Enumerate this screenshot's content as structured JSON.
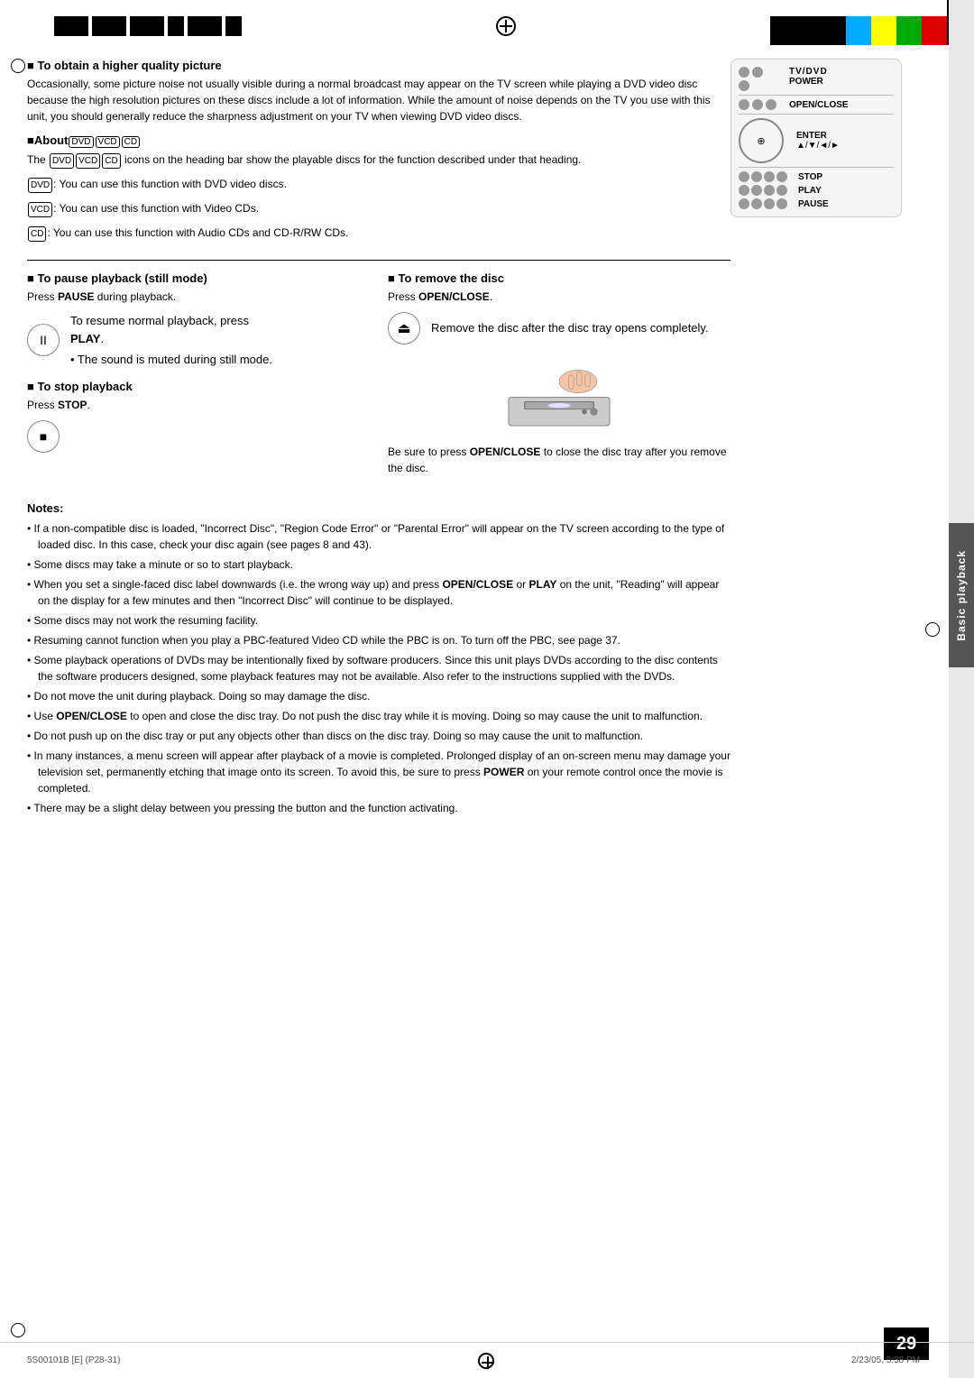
{
  "header": {
    "page_number": "29",
    "footer_left": "5S00101B [E] (P28-31)",
    "footer_center_page": "29",
    "footer_right": "2/23/05, 5:38 PM"
  },
  "sidebar": {
    "label": "Basic playback"
  },
  "top_section": {
    "higher_quality": {
      "heading": "To obtain a higher quality picture",
      "body": "Occasionally, some picture noise not usually visible during a normal broadcast may appear on the TV screen while playing a DVD video disc because the high resolution pictures on these discs include a lot of information. While the amount of noise depends on the TV you use with this unit, you should generally reduce the sharpness adjustment on your TV when viewing DVD video discs."
    },
    "about": {
      "heading": "About",
      "disc_labels": [
        "DVD",
        "VCD",
        "CD"
      ],
      "body": "icons on the heading bar show the playable discs for the function described under that heading.",
      "dvd_label": "DVD",
      "dvd_text": ": You can use this function with DVD video discs.",
      "vcd_label": "VCD",
      "vcd_text": ": You can use this function with Video CDs.",
      "cd_label": "CD",
      "cd_text": ": You can use this function with Audio CDs and CD-R/RW CDs."
    }
  },
  "remote": {
    "tv_dvd_label": "TV/DVD",
    "power_label": "POWER",
    "open_close_label": "OPEN/CLOSE",
    "enter_label": "ENTER",
    "nav_label": "▲/▼/◄/►",
    "stop_label": "STOP",
    "play_label": "PLAY",
    "pause_label": "PAUSE"
  },
  "middle_section": {
    "pause": {
      "heading": "To pause playback (still mode)",
      "press_text": "Press PAUSE during playback.",
      "pause_icon": "II",
      "resume_text": "To resume normal playback, press",
      "play_bold": "PLAY",
      "bullet": "The sound is muted during still mode."
    },
    "stop": {
      "heading": "To stop playback",
      "press_text": "Press STOP.",
      "stop_icon": "■"
    },
    "remove": {
      "heading": "To remove the disc",
      "press_text": "Press OPEN/CLOSE.",
      "open_close_icon": "⏏",
      "remove_text": "Remove the disc after the disc tray opens completely.",
      "note": "Be sure to press OPEN/CLOSE to close the disc tray after you remove the disc."
    }
  },
  "notes": {
    "heading": "Notes:",
    "items": [
      "If a non-compatible disc is loaded, \"Incorrect Disc\", \"Region Code Error\" or \"Parental Error\" will appear on the TV screen according to the type of loaded disc. In this case, check your disc again (see pages 8 and 43).",
      "Some discs may take a minute or so to start playback.",
      "When you set a single-faced disc label downwards (i.e. the wrong way up) and press OPEN/CLOSE or PLAY on the unit, \"Reading\" will appear on the display for a few minutes and then \"Incorrect Disc\" will continue to be displayed.",
      "Some discs may not work the resuming facility.",
      "Resuming cannot function when you play a PBC-featured Video CD while the PBC is on. To turn off the PBC, see page 37.",
      "Some playback operations of DVDs may be intentionally fixed by software producers. Since this unit plays DVDs according to the disc contents the software producers designed, some playback features may not be available. Also refer to the instructions supplied with the DVDs.",
      "Do not move the unit during playback. Doing so may damage the disc.",
      "Use OPEN/CLOSE to open and close the disc tray. Do not push the disc tray while it is moving. Doing so may cause the unit to malfunction.",
      "Do not push up on the disc tray or put any objects other than discs on the disc tray. Doing so may cause the unit to malfunction.",
      "In many instances, a menu screen will appear after playback of a movie is completed. Prolonged display of an on-screen menu may damage your television set, permanently etching that image onto its screen. To avoid this, be sure to press POWER on your remote control once the movie is completed.",
      "There may be a slight delay between you pressing the button and the function activating."
    ]
  }
}
